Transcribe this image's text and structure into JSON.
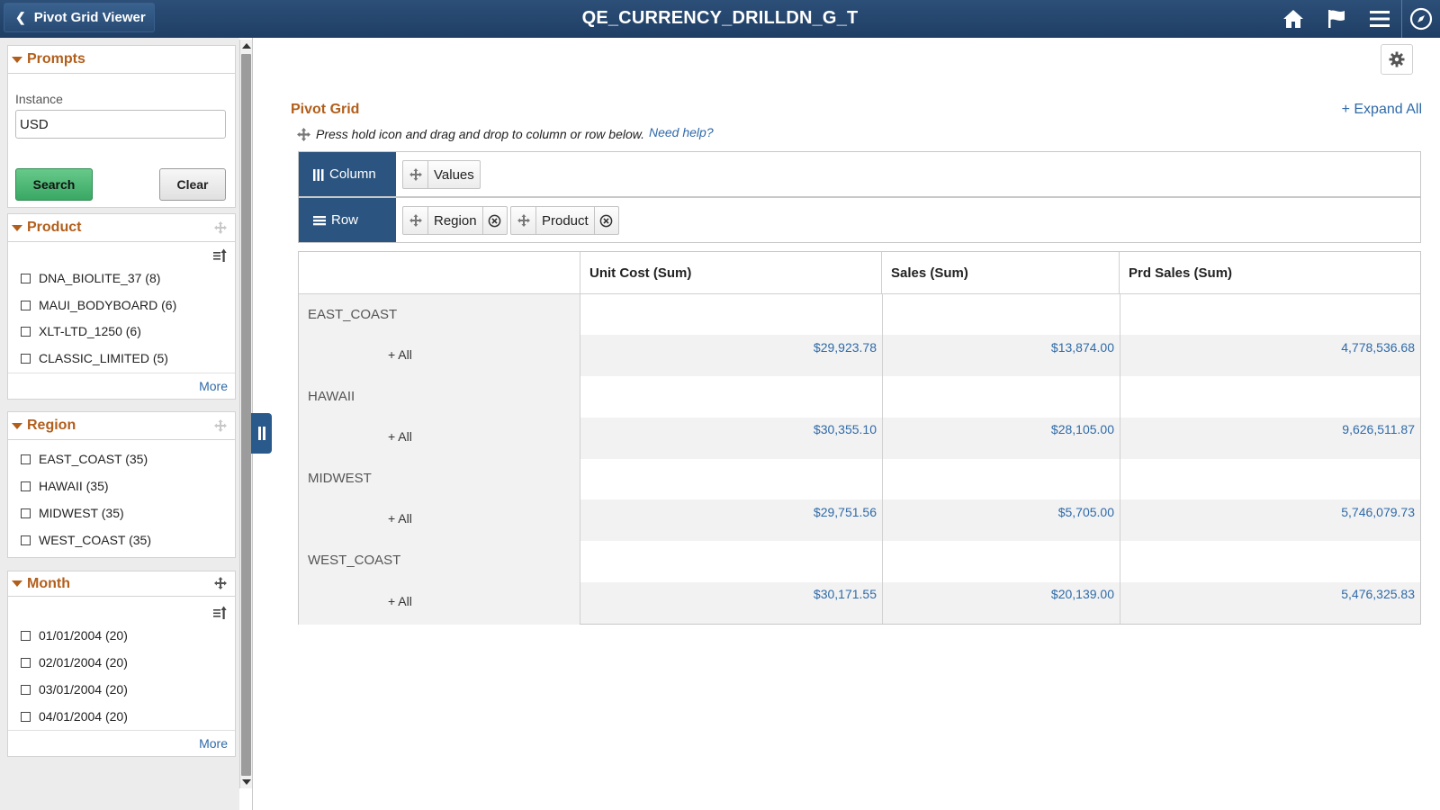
{
  "header": {
    "back_label": "Pivot Grid Viewer",
    "title": "QE_CURRENCY_DRILLDN_G_T",
    "icons": [
      "home-icon",
      "flag-icon",
      "menu-icon",
      "navigator-icon"
    ]
  },
  "prompts": {
    "title": "Prompts",
    "instance_label": "Instance",
    "instance_value": "USD",
    "search_label": "Search",
    "clear_label": "Clear"
  },
  "facets": {
    "product": {
      "title": "Product",
      "items": [
        "DNA_BIOLITE_37 (8)",
        "MAUI_BODYBOARD (6)",
        "XLT-LTD_1250 (6)",
        "CLASSIC_LIMITED (5)"
      ],
      "more": "More"
    },
    "region": {
      "title": "Region",
      "items": [
        "EAST_COAST (35)",
        "HAWAII (35)",
        "MIDWEST (35)",
        "WEST_COAST (35)"
      ]
    },
    "month": {
      "title": "Month",
      "items": [
        "01/01/2004 (20)",
        "02/01/2004 (20)",
        "03/01/2004 (20)",
        "04/01/2004 (20)"
      ],
      "more": "More"
    }
  },
  "main": {
    "title": "Pivot Grid",
    "expand_all": "+ Expand All",
    "hint": "Press hold icon and drag and drop to column or row below.",
    "help_link": "Need help?",
    "column_label": "Column",
    "row_label": "Row",
    "column_chips": [
      "Values"
    ],
    "row_chips": [
      "Region",
      "Product"
    ]
  },
  "grid": {
    "columns": [
      "Unit Cost (Sum)",
      "Sales (Sum)",
      "Prd Sales (Sum)"
    ],
    "all_label": "+ All",
    "rows": [
      {
        "region": "EAST_COAST",
        "values": [
          "$29,923.78",
          "$13,874.00",
          "4,778,536.68"
        ]
      },
      {
        "region": "HAWAII",
        "values": [
          "$30,355.10",
          "$28,105.00",
          "9,626,511.87"
        ]
      },
      {
        "region": "MIDWEST",
        "values": [
          "$29,751.56",
          "$5,705.00",
          "5,746,079.73"
        ]
      },
      {
        "region": "WEST_COAST",
        "values": [
          "$30,171.55",
          "$20,139.00",
          "5,476,325.83"
        ]
      }
    ]
  },
  "colors": {
    "header_bg": "#1f3e64",
    "accent_orange": "#b25e1b",
    "link_blue": "#2f6aa8",
    "search_green": "#3aa864"
  }
}
